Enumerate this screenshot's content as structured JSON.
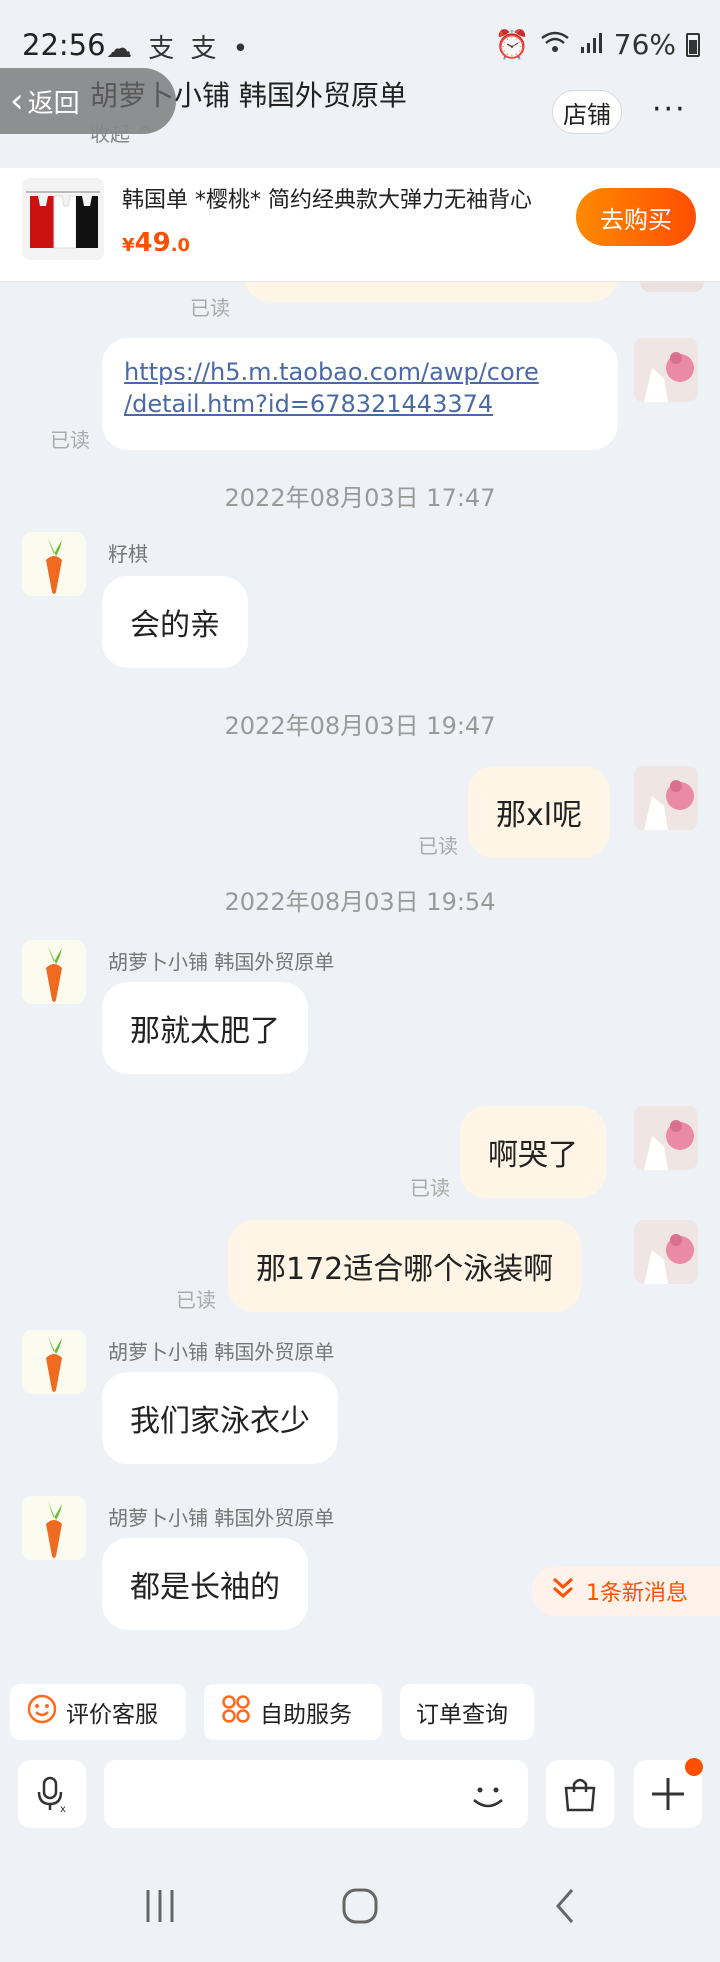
{
  "status_bar": {
    "time": "22:56",
    "left_icons": "☁ 支 支 •",
    "battery": "76%"
  },
  "header": {
    "back_label": "返回",
    "shop_title": "胡萝卜小铺  韩国外贸原单",
    "collapse_label": "收起",
    "store_label": "店铺",
    "more_label": "···"
  },
  "product": {
    "name": "韩国单  *樱桃* 简约经典款大弹力无袖背心",
    "price_symbol": "¥",
    "price_int": "49",
    "price_dec": ".0",
    "buy_label": "去购买"
  },
  "chat": {
    "messages": [
      {
        "type": "partial",
        "read": "已读"
      },
      {
        "type": "link",
        "text_line1": "https://h5.m.taobao.com/awp/core",
        "text_line2": "/detail.htm?id=678321443374",
        "read": "已读"
      },
      {
        "type": "timestamp",
        "text": "2022年08月03日 17:47"
      },
      {
        "type": "in",
        "sender": "籽棋",
        "text": "会的亲"
      },
      {
        "type": "timestamp",
        "text": "2022年08月03日 19:47"
      },
      {
        "type": "out",
        "text": "那xl呢",
        "read": "已读"
      },
      {
        "type": "timestamp",
        "text": "2022年08月03日 19:54"
      },
      {
        "type": "in",
        "sender": "胡萝卜小铺  韩国外贸原单",
        "text": "那就太肥了"
      },
      {
        "type": "out",
        "text": "啊哭了",
        "read": "已读"
      },
      {
        "type": "out",
        "text": "那172适合哪个泳装啊",
        "read": "已读"
      },
      {
        "type": "in",
        "sender": "胡萝卜小铺  韩国外贸原单",
        "text": "我们家泳衣少"
      },
      {
        "type": "in",
        "sender": "胡萝卜小铺  韩国外贸原单",
        "text": "都是长袖的"
      }
    ],
    "new_messages": "1条新消息"
  },
  "quick_actions": [
    {
      "label": "评价客服",
      "icon": "smiley-icon"
    },
    {
      "label": "自助服务",
      "icon": "grid-icon"
    },
    {
      "label": "订单查询",
      "icon": ""
    }
  ],
  "input": {
    "placeholder": ""
  },
  "colors": {
    "accent": "#ff5000",
    "bubble_out": "#fff5e6",
    "bubble_in": "#ffffff",
    "background": "#eef1f6"
  }
}
